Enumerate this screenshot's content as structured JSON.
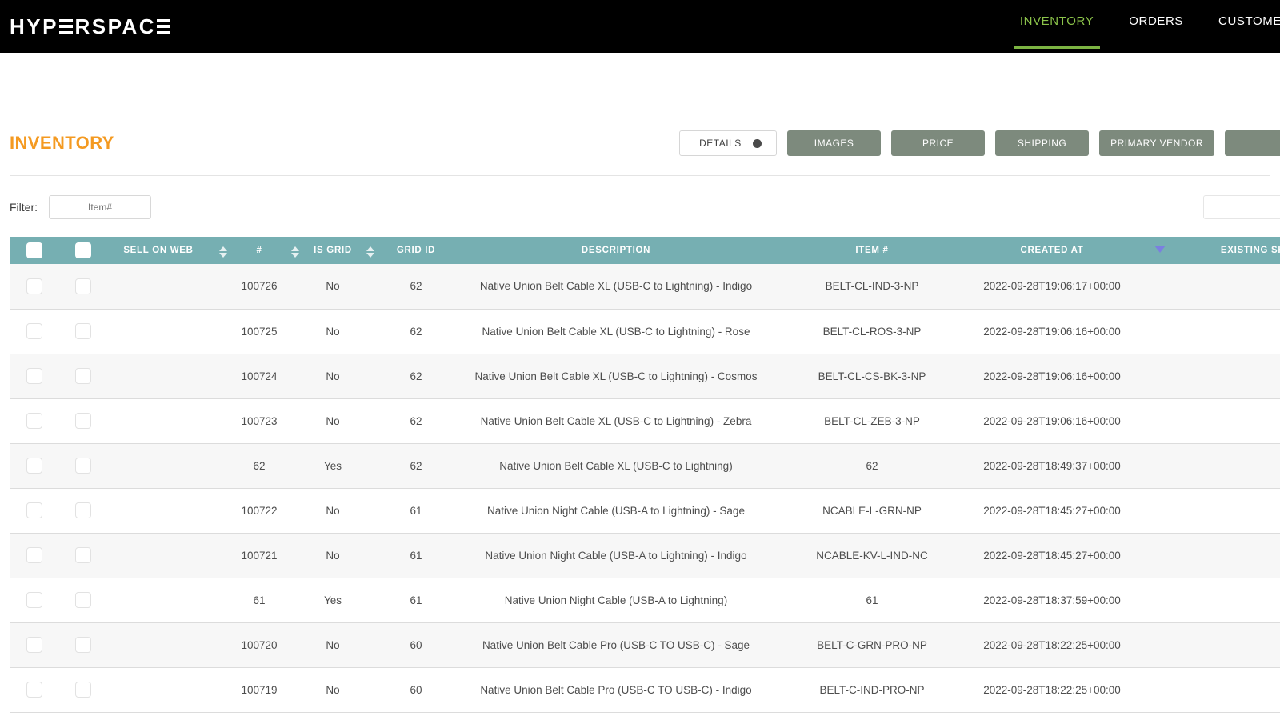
{
  "brand": {
    "logo_text": "HYPERSPACE",
    "logo_part1": "HYP",
    "logo_part2": "RSPAC",
    "accent_green": "#7cb342"
  },
  "nav": {
    "items": [
      {
        "label": "INVENTORY",
        "active": true
      },
      {
        "label": "ORDERS",
        "active": false
      },
      {
        "label": "CUSTOMERS",
        "active": false
      }
    ]
  },
  "header": {
    "page_title": "INVENTORY",
    "title_color": "#f49a21"
  },
  "toolbar": {
    "tabs": [
      {
        "label": "DETAILS",
        "active": true,
        "has_dot": true
      },
      {
        "label": "IMAGES",
        "active": false
      },
      {
        "label": "PRICE",
        "active": false
      },
      {
        "label": "SHIPPING",
        "active": false
      },
      {
        "label": "PRIMARY VENDOR",
        "active": false
      },
      {
        "label": "",
        "active": false
      }
    ]
  },
  "filter": {
    "label": "Filter:",
    "item_placeholder": "Item#",
    "item_value": ""
  },
  "table": {
    "header_color": "#76afb2",
    "sort_active_color": "#7b7fe0",
    "columns": [
      {
        "key": "select_all",
        "label": "",
        "sortable": false
      },
      {
        "key": "row_select",
        "label": "",
        "sortable": false
      },
      {
        "key": "sell_on_web",
        "label": "SELL ON WEB",
        "sortable": true
      },
      {
        "key": "number",
        "label": "#",
        "sortable": true
      },
      {
        "key": "is_grid",
        "label": "IS GRID",
        "sortable": true
      },
      {
        "key": "grid_id",
        "label": "GRID ID",
        "sortable": false
      },
      {
        "key": "description",
        "label": "DESCRIPTION",
        "sortable": false
      },
      {
        "key": "item_number",
        "label": "ITEM #",
        "sortable": false
      },
      {
        "key": "created_at",
        "label": "CREATED AT",
        "sortable": true,
        "sort_state": "desc"
      },
      {
        "key": "existing_sku",
        "label": "EXISTING SKU [WEB STORE]",
        "sortable": false
      }
    ],
    "rows": [
      {
        "number": "100726",
        "is_grid": "No",
        "grid_id": "62",
        "description": "Native Union Belt Cable XL (USB-C to Lightning) - Indigo",
        "item_number": "BELT-CL-IND-3-NP",
        "created_at": "2022-09-28T19:06:17+00:00",
        "existing_sku": ""
      },
      {
        "number": "100725",
        "is_grid": "No",
        "grid_id": "62",
        "description": "Native Union Belt Cable XL (USB-C to Lightning) - Rose",
        "item_number": "BELT-CL-ROS-3-NP",
        "created_at": "2022-09-28T19:06:16+00:00",
        "existing_sku": ""
      },
      {
        "number": "100724",
        "is_grid": "No",
        "grid_id": "62",
        "description": "Native Union Belt Cable XL (USB-C to Lightning) - Cosmos",
        "item_number": "BELT-CL-CS-BK-3-NP",
        "created_at": "2022-09-28T19:06:16+00:00",
        "existing_sku": ""
      },
      {
        "number": "100723",
        "is_grid": "No",
        "grid_id": "62",
        "description": "Native Union Belt Cable XL (USB-C to Lightning) - Zebra",
        "item_number": "BELT-CL-ZEB-3-NP",
        "created_at": "2022-09-28T19:06:16+00:00",
        "existing_sku": ""
      },
      {
        "number": "62",
        "is_grid": "Yes",
        "grid_id": "62",
        "description": "Native Union Belt Cable XL (USB-C to Lightning)",
        "item_number": "62",
        "created_at": "2022-09-28T18:49:37+00:00",
        "existing_sku": ""
      },
      {
        "number": "100722",
        "is_grid": "No",
        "grid_id": "61",
        "description": "Native Union Night Cable (USB-A to Lightning) - Sage",
        "item_number": "NCABLE-L-GRN-NP",
        "created_at": "2022-09-28T18:45:27+00:00",
        "existing_sku": ""
      },
      {
        "number": "100721",
        "is_grid": "No",
        "grid_id": "61",
        "description": "Native Union Night Cable (USB-A to Lightning) - Indigo",
        "item_number": "NCABLE-KV-L-IND-NC",
        "created_at": "2022-09-28T18:45:27+00:00",
        "existing_sku": ""
      },
      {
        "number": "61",
        "is_grid": "Yes",
        "grid_id": "61",
        "description": "Native Union Night Cable (USB-A to Lightning)",
        "item_number": "61",
        "created_at": "2022-09-28T18:37:59+00:00",
        "existing_sku": ""
      },
      {
        "number": "100720",
        "is_grid": "No",
        "grid_id": "60",
        "description": "Native Union Belt Cable Pro (USB-C TO USB-C) - Sage",
        "item_number": "BELT-C-GRN-PRO-NP",
        "created_at": "2022-09-28T18:22:25+00:00",
        "existing_sku": ""
      },
      {
        "number": "100719",
        "is_grid": "No",
        "grid_id": "60",
        "description": "Native Union Belt Cable Pro (USB-C TO USB-C) - Indigo",
        "item_number": "BELT-C-IND-PRO-NP",
        "created_at": "2022-09-28T18:22:25+00:00",
        "existing_sku": ""
      }
    ]
  }
}
